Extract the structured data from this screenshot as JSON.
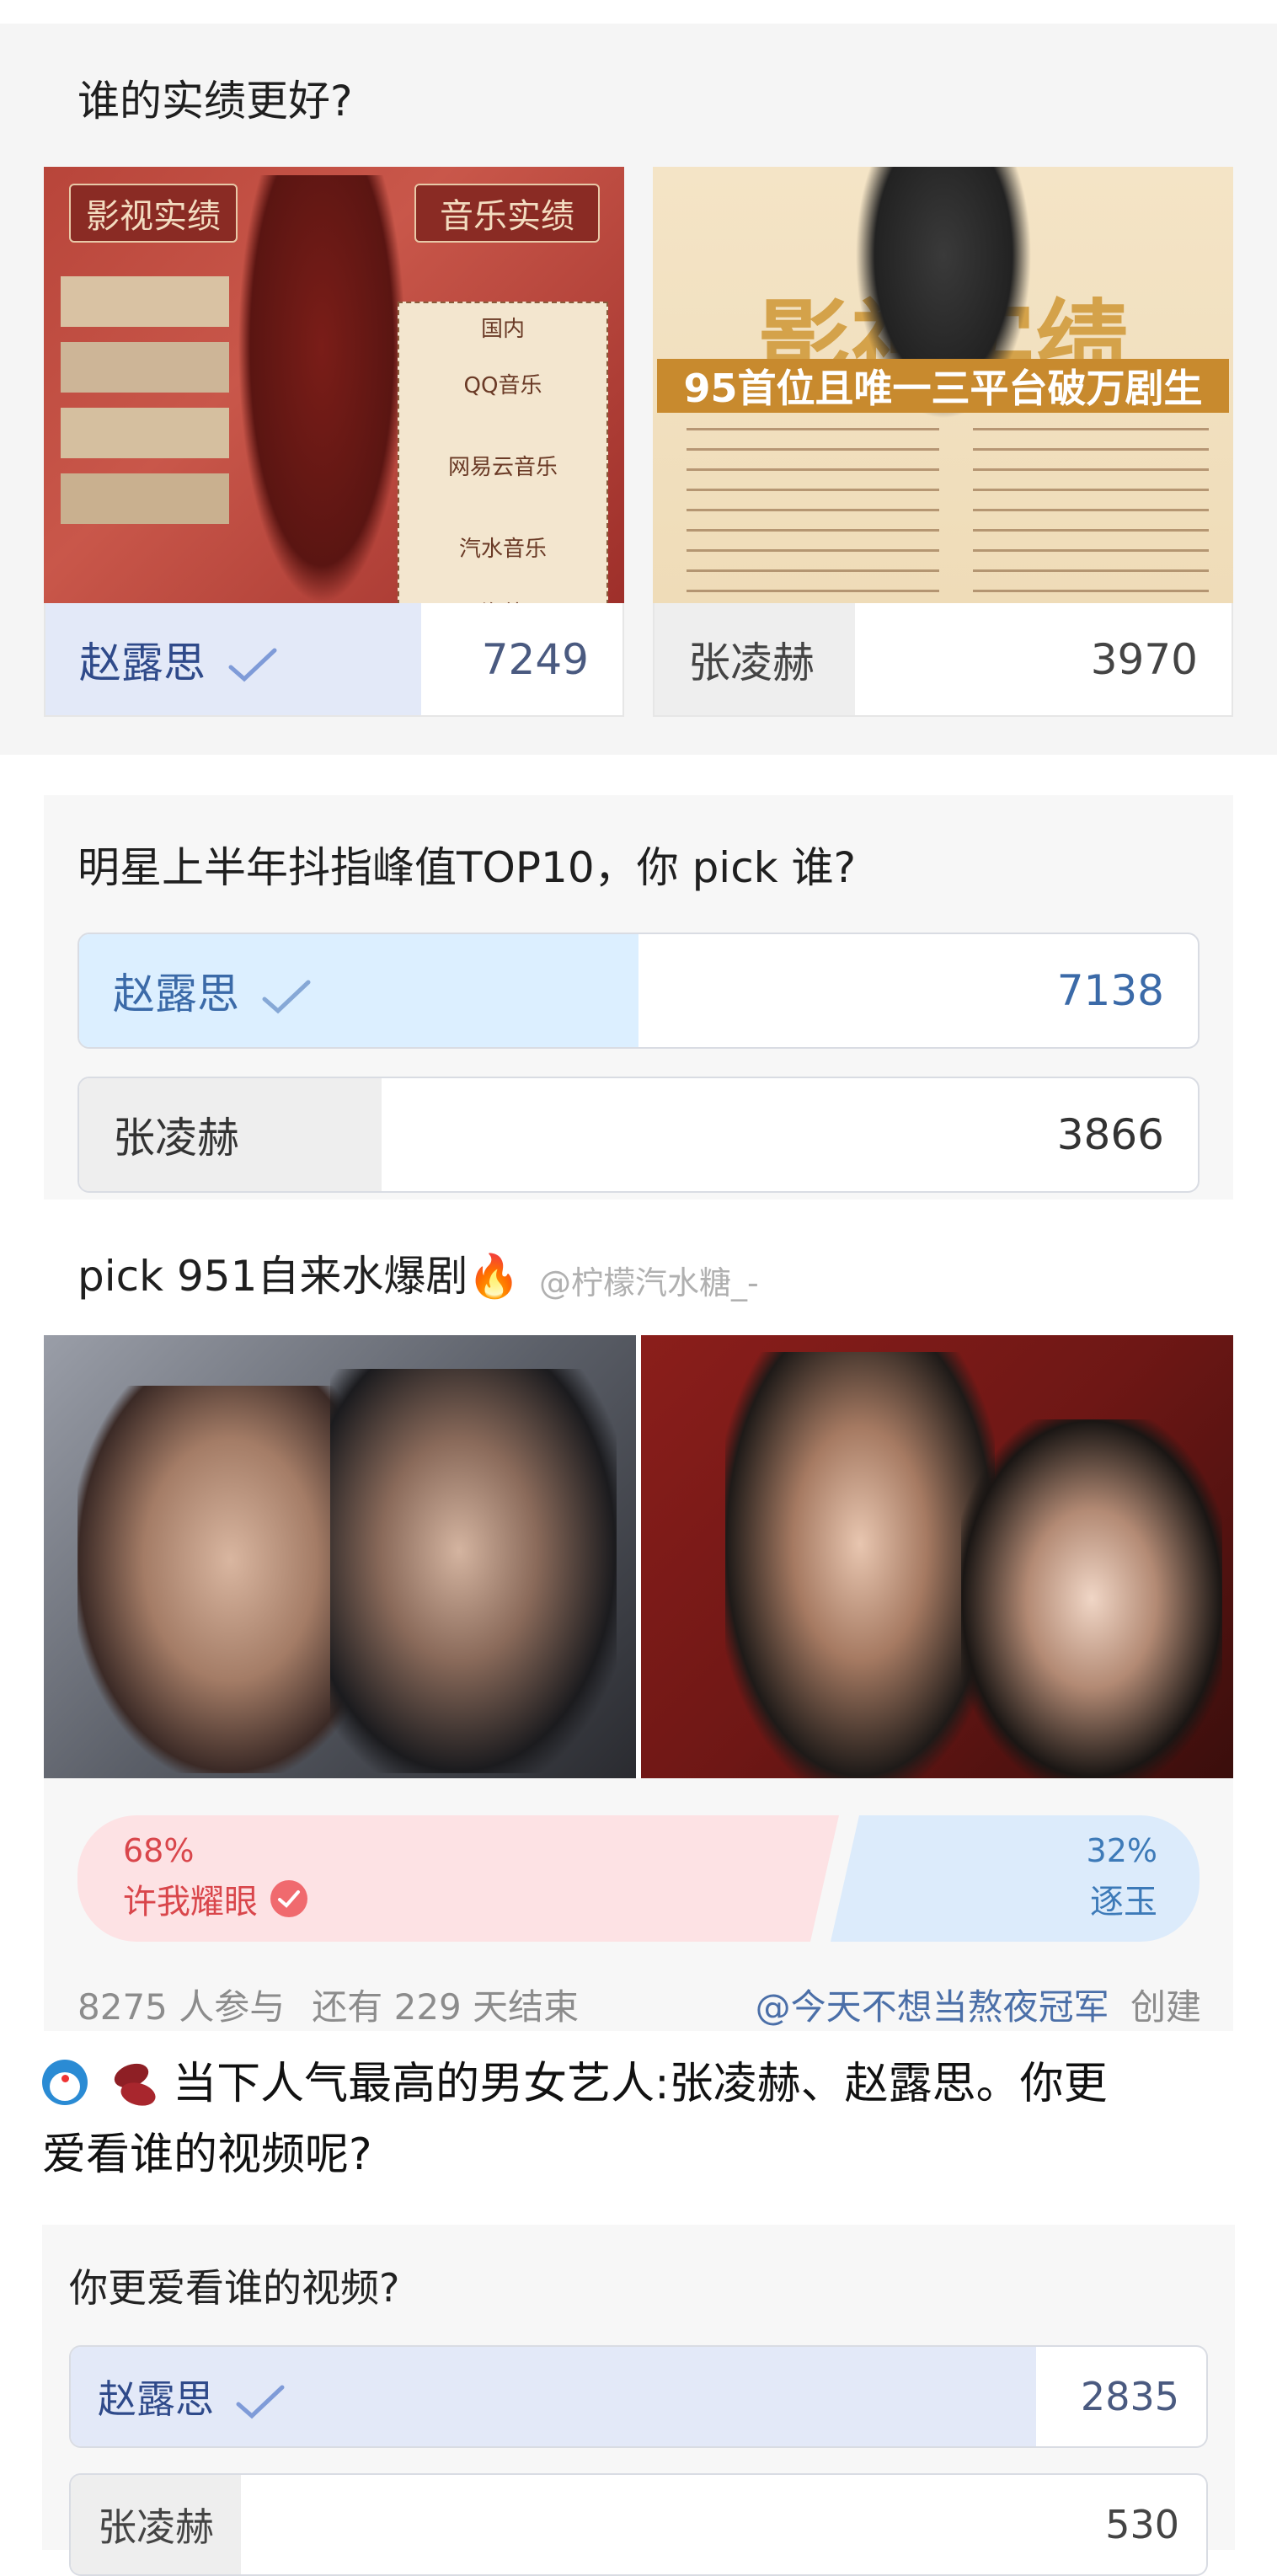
{
  "poll1": {
    "title": "谁的实绩更好?",
    "left_image_texts": [
      "影视实绩",
      "音乐实绩",
      "国内",
      "QQ音乐",
      "网易云音乐",
      "汽水音乐",
      "海外"
    ],
    "right_image_texts": [
      "影视实绩",
      "95首位且唯一三平台破万剧生"
    ],
    "options": [
      {
        "name": "赵露思",
        "count": "7249",
        "selected": true
      },
      {
        "name": "张凌赫",
        "count": "3970",
        "selected": false
      }
    ]
  },
  "poll2": {
    "title": "明星上半年抖指峰值TOP10，你 pick 谁?",
    "options": [
      {
        "name": "赵露思",
        "count": "7138",
        "fraction": 0.5,
        "selected": true
      },
      {
        "name": "张凌赫",
        "count": "3866",
        "fraction": 0.27,
        "selected": false
      }
    ]
  },
  "poll3": {
    "title": "pick 951自来水爆剧",
    "watermark": "@柠檬汽水糖_-",
    "left": {
      "percent": "68%",
      "name": "许我耀眼",
      "fraction": 0.68,
      "selected": true
    },
    "right": {
      "percent": "32%",
      "name": "逐玉"
    },
    "participants": "8275 人参与",
    "remaining": "还有 229 天结束",
    "creator": "@今天不想当熬夜冠军",
    "created_label": "创建"
  },
  "post": {
    "text_line1": "当下人气最高的男女艺人:张凌赫、赵露思。你更",
    "text_line2": "爱看谁的视频呢?",
    "icons": [
      "doraemon-emoji",
      "beans-emoji"
    ]
  },
  "poll4": {
    "title": "你更爱看谁的视频?",
    "options": [
      {
        "name": "赵露思",
        "count": "2835",
        "fraction": 0.85,
        "selected": true
      },
      {
        "name": "张凌赫",
        "count": "530",
        "fraction": 0.15,
        "selected": false
      }
    ]
  },
  "colors": {
    "selected_fill": "#e3e9f8",
    "selected_fill_blue": "#dcefff",
    "unselected_fill": "#eeeeee",
    "accent_blue": "#4a6fd0",
    "pink": "#fde2e4",
    "pink_text": "#d9464b"
  }
}
